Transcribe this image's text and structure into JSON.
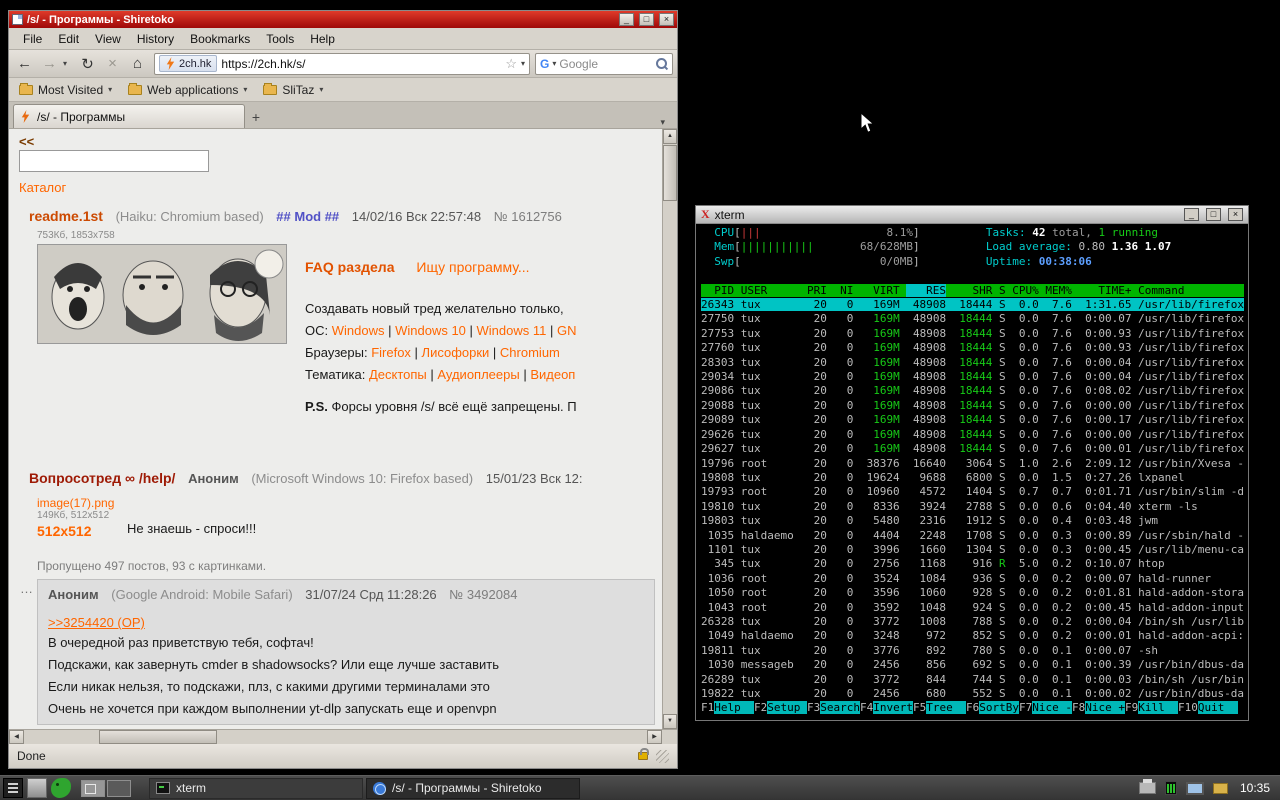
{
  "icons": {
    "back": "←",
    "forward": "→",
    "chevron": "▾",
    "reload": "↻",
    "stop": "×",
    "home": "⌂",
    "star": "☆",
    "new_tab": "+",
    "scroll_up": "▲",
    "scroll_down": "▼",
    "scroll_left": "◀",
    "scroll_right": "▶",
    "post_dots": "…",
    "minimize": "_",
    "maximize": "□",
    "close": "×",
    "google_g": "G",
    "xlogo": "X"
  },
  "browser": {
    "title": "/s/ - Программы - Shiretoko",
    "menu": [
      "File",
      "Edit",
      "View",
      "History",
      "Bookmarks",
      "Tools",
      "Help"
    ],
    "urlbar": {
      "site_badge": "2ch.hk",
      "url": "https://2ch.hk/s/",
      "search_engine": "Google"
    },
    "bookmarks": [
      "Most Visited",
      "Web applications",
      "SliTaz"
    ],
    "tab_label": "/s/ - Программы",
    "status": "Done",
    "page": {
      "back_link": "<<",
      "catalog_link": "Каталог",
      "thread1": {
        "subject": "readme.1st",
        "useragent": "(Haiku: Chromium based)",
        "mod": "## Mod ##",
        "date": "14/02/16 Вск 22:57:48",
        "num": "№ 1612756",
        "filemeta": "753Кб, 1853x758",
        "faq_title": "FAQ раздела",
        "faq_link": "Ищу программу...",
        "line1": "Создавать новый тред желательно только,",
        "os_label": "ОС:",
        "os_links": [
          "Windows",
          "Windows 10",
          "Windows 11",
          "GN"
        ],
        "browsers_label": "Браузеры:",
        "browser_links": [
          "Firefox",
          "Лисофорки",
          "Chromium"
        ],
        "theme_label": "Тематика:",
        "theme_links": [
          "Десктопы",
          "Аудиоплееры",
          "Видеоп"
        ],
        "ps_bold": "P.S.",
        "ps_text": " Форсы уровня /s/ всё ещё запрещены. П"
      },
      "thread2": {
        "subject": "Вопросотред ∞ /help/",
        "author": "Аноним",
        "useragent": "(Microsoft Windows 10: Firefox based)",
        "date": "15/01/23 Вск 12:",
        "filename": "image(17).png",
        "filemeta": "149Кб, 512x512",
        "thumb_text": "512x512",
        "text": "Не знаешь - спроси!!!",
        "omitted": "Пропущено 497 постов, 93 с картинками."
      },
      "post": {
        "author": "Аноним",
        "useragent": "(Google Android: Mobile Safari)",
        "date": "31/07/24 Срд 11:28:26",
        "num": "№ 3492084",
        "reply_link": ">>3254420 (OP)",
        "lines": [
          "В очередной раз приветствую тебя, софтач!",
          "Подскажи, как завернуть cmder в shadowsocks? Или еще лучше заставить",
          "Если никак нельзя, то подскажи, плз, с какими другими терминалами это",
          "Очень не хочется при каждом выполнении yt-dlp запускать еще и openvpn"
        ]
      }
    }
  },
  "xterm": {
    "title": "xterm",
    "htop": {
      "cpu": {
        "label": "CPU",
        "bar": "|||",
        "value": "8.1%"
      },
      "mem": {
        "label": "Mem",
        "bar": "|||||||||||",
        "value": "68/628MB"
      },
      "swp": {
        "label": "Swp",
        "bar": "",
        "value": "0/0MB"
      },
      "tasks": {
        "label": "Tasks:",
        "total": "42",
        "total_word": "total,",
        "running": "1",
        "running_word": "running"
      },
      "load": {
        "label": "Load average:",
        "v": [
          "0.80",
          "1.36",
          "1.07"
        ]
      },
      "uptime": {
        "label": "Uptime:",
        "value": "00:38:06"
      },
      "columns": [
        "PID",
        "USER",
        "PRI",
        "NI",
        "VIRT",
        "RES",
        "SHR",
        "S",
        "CPU%",
        "MEM%",
        "TIME+",
        "Command"
      ],
      "sort_column": "RES",
      "selected_pid": "26343",
      "rows": [
        [
          "26343",
          "tux",
          "20",
          "0",
          "169M",
          "48908",
          "18444",
          "S",
          "0.0",
          "7.6",
          "1:31.65",
          "/usr/lib/firefox"
        ],
        [
          "27750",
          "tux",
          "20",
          "0",
          "169M",
          "48908",
          "18444",
          "S",
          "0.0",
          "7.6",
          "0:00.07",
          "/usr/lib/firefox"
        ],
        [
          "27753",
          "tux",
          "20",
          "0",
          "169M",
          "48908",
          "18444",
          "S",
          "0.0",
          "7.6",
          "0:00.93",
          "/usr/lib/firefox"
        ],
        [
          "27760",
          "tux",
          "20",
          "0",
          "169M",
          "48908",
          "18444",
          "S",
          "0.0",
          "7.6",
          "0:00.93",
          "/usr/lib/firefox"
        ],
        [
          "28303",
          "tux",
          "20",
          "0",
          "169M",
          "48908",
          "18444",
          "S",
          "0.0",
          "7.6",
          "0:00.04",
          "/usr/lib/firefox"
        ],
        [
          "29034",
          "tux",
          "20",
          "0",
          "169M",
          "48908",
          "18444",
          "S",
          "0.0",
          "7.6",
          "0:00.04",
          "/usr/lib/firefox"
        ],
        [
          "29086",
          "tux",
          "20",
          "0",
          "169M",
          "48908",
          "18444",
          "S",
          "0.0",
          "7.6",
          "0:08.02",
          "/usr/lib/firefox"
        ],
        [
          "29088",
          "tux",
          "20",
          "0",
          "169M",
          "48908",
          "18444",
          "S",
          "0.0",
          "7.6",
          "0:00.00",
          "/usr/lib/firefox"
        ],
        [
          "29089",
          "tux",
          "20",
          "0",
          "169M",
          "48908",
          "18444",
          "S",
          "0.0",
          "7.6",
          "0:00.17",
          "/usr/lib/firefox"
        ],
        [
          "29626",
          "tux",
          "20",
          "0",
          "169M",
          "48908",
          "18444",
          "S",
          "0.0",
          "7.6",
          "0:00.00",
          "/usr/lib/firefox"
        ],
        [
          "29627",
          "tux",
          "20",
          "0",
          "169M",
          "48908",
          "18444",
          "S",
          "0.0",
          "7.6",
          "0:00.01",
          "/usr/lib/firefox"
        ],
        [
          "19796",
          "root",
          "20",
          "0",
          "38376",
          "16640",
          "3064",
          "S",
          "1.0",
          "2.6",
          "2:09.12",
          "/usr/bin/Xvesa -"
        ],
        [
          "19808",
          "tux",
          "20",
          "0",
          "19624",
          "9688",
          "6800",
          "S",
          "0.0",
          "1.5",
          "0:27.26",
          "lxpanel"
        ],
        [
          "19793",
          "root",
          "20",
          "0",
          "10960",
          "4572",
          "1404",
          "S",
          "0.7",
          "0.7",
          "0:01.71",
          "/usr/bin/slim -d"
        ],
        [
          "19810",
          "tux",
          "20",
          "0",
          "8336",
          "3924",
          "2788",
          "S",
          "0.0",
          "0.6",
          "0:04.40",
          "xterm -ls"
        ],
        [
          "19803",
          "tux",
          "20",
          "0",
          "5480",
          "2316",
          "1912",
          "S",
          "0.0",
          "0.4",
          "0:03.48",
          "jwm"
        ],
        [
          "1035",
          "haldaemo",
          "20",
          "0",
          "4404",
          "2248",
          "1708",
          "S",
          "0.0",
          "0.3",
          "0:00.89",
          "/usr/sbin/hald -"
        ],
        [
          "1101",
          "tux",
          "20",
          "0",
          "3996",
          "1660",
          "1304",
          "S",
          "0.0",
          "0.3",
          "0:00.45",
          "/usr/lib/menu-ca"
        ],
        [
          "345",
          "tux",
          "20",
          "0",
          "2756",
          "1168",
          "916",
          "R",
          "5.0",
          "0.2",
          "0:10.07",
          "htop"
        ],
        [
          "1036",
          "root",
          "20",
          "0",
          "3524",
          "1084",
          "936",
          "S",
          "0.0",
          "0.2",
          "0:00.07",
          "hald-runner"
        ],
        [
          "1050",
          "root",
          "20",
          "0",
          "3596",
          "1060",
          "928",
          "S",
          "0.0",
          "0.2",
          "0:01.81",
          "hald-addon-stora"
        ],
        [
          "1043",
          "root",
          "20",
          "0",
          "3592",
          "1048",
          "924",
          "S",
          "0.0",
          "0.2",
          "0:00.45",
          "hald-addon-input"
        ],
        [
          "26328",
          "tux",
          "20",
          "0",
          "3772",
          "1008",
          "788",
          "S",
          "0.0",
          "0.2",
          "0:00.04",
          "/bin/sh /usr/lib"
        ],
        [
          "1049",
          "haldaemo",
          "20",
          "0",
          "3248",
          "972",
          "852",
          "S",
          "0.0",
          "0.2",
          "0:00.01",
          "hald-addon-acpi:"
        ],
        [
          "19811",
          "tux",
          "20",
          "0",
          "3776",
          "892",
          "780",
          "S",
          "0.0",
          "0.1",
          "0:00.07",
          "-sh"
        ],
        [
          "1030",
          "messageb",
          "20",
          "0",
          "2456",
          "856",
          "692",
          "S",
          "0.0",
          "0.1",
          "0:00.39",
          "/usr/bin/dbus-da"
        ],
        [
          "26289",
          "tux",
          "20",
          "0",
          "3772",
          "844",
          "744",
          "S",
          "0.0",
          "0.1",
          "0:00.03",
          "/bin/sh /usr/bin"
        ],
        [
          "19822",
          "tux",
          "20",
          "0",
          "2456",
          "680",
          "552",
          "S",
          "0.0",
          "0.1",
          "0:00.02",
          "/usr/bin/dbus-da"
        ]
      ]
    },
    "fkeys": [
      [
        "F1",
        "Help"
      ],
      [
        "F2",
        "Setup"
      ],
      [
        "F3",
        "Search"
      ],
      [
        "F4",
        "Invert"
      ],
      [
        "F5",
        "Tree"
      ],
      [
        "F6",
        "SortBy"
      ],
      [
        "F7",
        "Nice -"
      ],
      [
        "F8",
        "Nice +"
      ],
      [
        "F9",
        "Kill"
      ],
      [
        "F10",
        "Quit"
      ]
    ]
  },
  "taskbar": {
    "tasks": [
      {
        "label": "xterm"
      },
      {
        "label": "/s/ - Программы - Shiretoko"
      }
    ],
    "clock": "10:35"
  }
}
